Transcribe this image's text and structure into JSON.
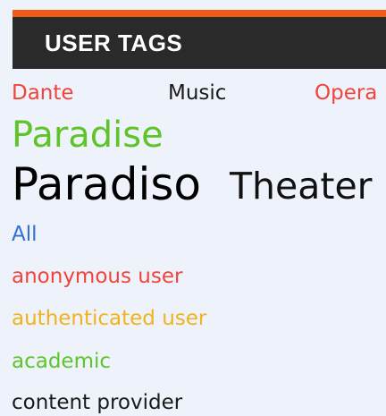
{
  "header": {
    "title": "USER TAGS"
  },
  "tags": [
    {
      "label": "Dante",
      "color": "#f0443a"
    },
    {
      "label": "Music",
      "color": "#1a1a1a"
    },
    {
      "label": "Opera",
      "color": "#f0443a"
    },
    {
      "label": "Paradise",
      "color": "#5ec42a"
    },
    {
      "label": "Paradiso",
      "color": "#000000"
    },
    {
      "label": "Theater",
      "color": "#111111"
    }
  ],
  "roles": [
    {
      "label": "All",
      "color": "#2f6fd6"
    },
    {
      "label": "anonymous user",
      "color": "#f0443a"
    },
    {
      "label": "authenticated user",
      "color": "#f2b21b"
    },
    {
      "label": "academic",
      "color": "#5ec42a"
    },
    {
      "label": "content provider",
      "color": "#1a1a1a"
    }
  ],
  "colors": {
    "accent_bar": "#f25a1a",
    "header_bg": "#2a2a2a",
    "page_bg": "#eef3fb"
  }
}
